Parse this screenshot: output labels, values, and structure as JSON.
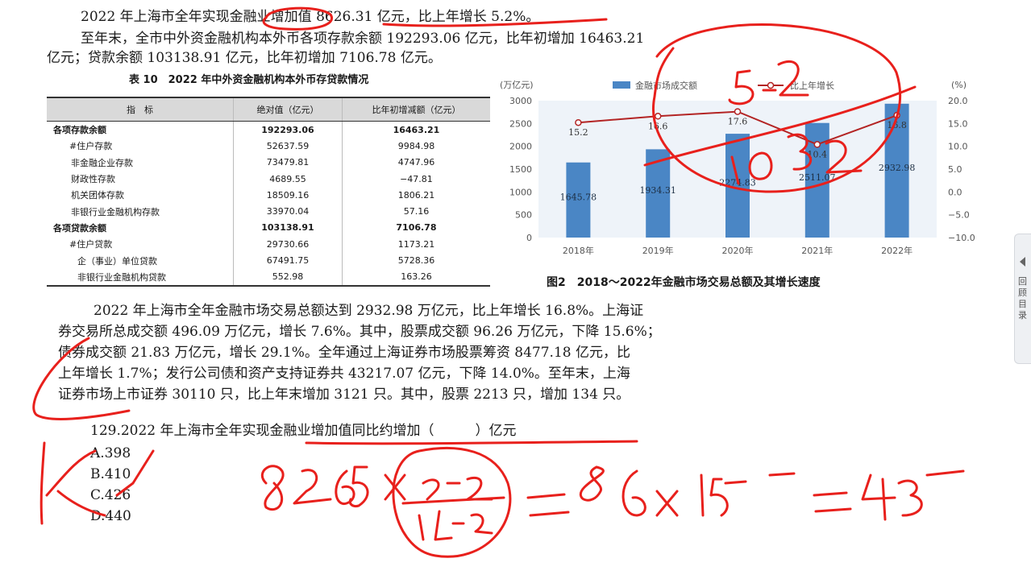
{
  "paragraphs": {
    "p1": "2022 年上海市全年实现金融业增加值 8626.31 亿元，比上年增长 5.2%。",
    "p2a": "至年末，全市中外资金融机构本外币各项存款余额 192293.06 亿元，比年初增加 16463.21",
    "p2b": "亿元；贷款余额 103138.91 亿元，比年初增加 7106.78 亿元。",
    "p3a": "2022 年上海市全年金融市场交易总额达到 2932.98 万亿元，比上年增长 16.8%。上海证",
    "p3b": "券交易所总成交额 496.09 万亿元，增长 7.6%。其中，股票成交额 96.26 万亿元，下降 15.6%；",
    "p3c": "债券成交额 21.83 万亿元，增长 29.1%。全年通过上海证券市场股票筹资 8477.18 亿元，比",
    "p3d": "上年增长 1.7%；发行公司债和资产支持证券共 43217.07 亿元，下降 14.0%。至年末，上海",
    "p3e": "证券市场上市证券 30110 只，比上年末增加 3121 只。其中，股票 2213 只，增加 134 只。"
  },
  "table": {
    "title": "表 10　2022 年中外资金融机构本外币存贷款情况",
    "headers": [
      "指　标",
      "绝对值（亿元）",
      "比年初增减额（亿元）"
    ],
    "rows": [
      {
        "label": "各项存款余额",
        "abs": "192293.06",
        "chg": "16463.21"
      },
      {
        "label": "#住户存款",
        "abs": "52637.59",
        "chg": "9984.98"
      },
      {
        "label": "非金融企业存款",
        "abs": "73479.81",
        "chg": "4747.96"
      },
      {
        "label": "财政性存款",
        "abs": "4689.55",
        "chg": "−47.81"
      },
      {
        "label": "机关团体存款",
        "abs": "18509.16",
        "chg": "1806.21"
      },
      {
        "label": "非银行业金融机构存款",
        "abs": "33970.04",
        "chg": "57.16"
      },
      {
        "label": "各项贷款余额",
        "abs": "103138.91",
        "chg": "7106.78"
      },
      {
        "label": "#住户贷款",
        "abs": "29730.66",
        "chg": "1173.21"
      },
      {
        "label": "企（事业）单位贷款",
        "abs": "67491.75",
        "chg": "5728.36"
      },
      {
        "label": "非银行业金融机构贷款",
        "abs": "552.98",
        "chg": "163.26"
      }
    ]
  },
  "chart_data": {
    "type": "bar",
    "title": "图2　2018～2022年金融市场交易总额及其增长速度",
    "categories": [
      "2018年",
      "2019年",
      "2020年",
      "2021年",
      "2022年"
    ],
    "ylabel_left": "(万亿元)",
    "ylabel_right": "(%)",
    "ylim_left": [
      0,
      3000
    ],
    "ylim_right": [
      -10,
      20
    ],
    "yticks_left": [
      "0",
      "500",
      "1000",
      "1500",
      "2000",
      "2500",
      "3000"
    ],
    "yticks_right": [
      "−10.0",
      "−5.0",
      "0.0",
      "5.0",
      "10.0",
      "15.0",
      "20.0"
    ],
    "series": [
      {
        "name": "金融市场成交额",
        "kind": "bar",
        "axis": "left",
        "values": [
          1645.78,
          1934.31,
          2274.83,
          2511.07,
          2932.98
        ],
        "labels": [
          "1645.78",
          "1934.31",
          "2274.83",
          "2511.07",
          "2932.98"
        ]
      },
      {
        "name": "比上年增长",
        "kind": "line",
        "axis": "right",
        "values": [
          15.2,
          16.6,
          17.6,
          10.4,
          16.8
        ],
        "labels": [
          "15.2",
          "16.6",
          "17.6",
          "10.4",
          "16.8"
        ]
      }
    ],
    "bar_color": "#4a86c5",
    "line_color": "#b32424",
    "legend": "top"
  },
  "question": {
    "stem": "129.2022 年上海市全年实现金融业增加值同比约增加（　　　）亿元",
    "options": [
      "A.398",
      "B.410",
      "C.426",
      "D.440"
    ]
  },
  "sidebar": {
    "label": "回顾目录"
  },
  "annotation_color": "#e8201c"
}
